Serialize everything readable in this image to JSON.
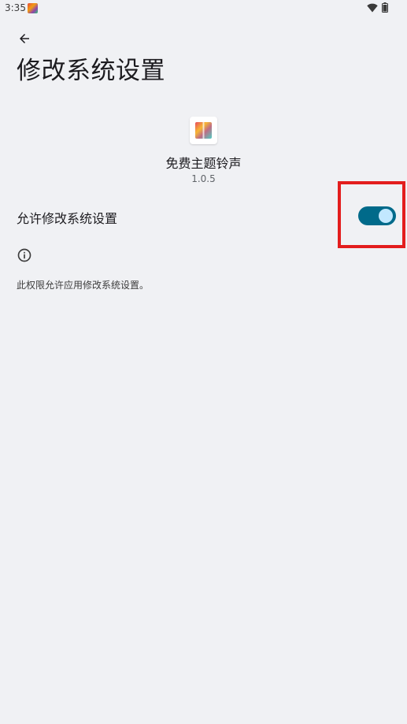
{
  "status_bar": {
    "time": "3:35",
    "notification_icon": "app-notification-icon",
    "wifi_icon": "wifi-icon",
    "battery_icon": "battery-icon"
  },
  "toolbar": {
    "back_icon": "arrow-back-icon",
    "title": "修改系统设置"
  },
  "app": {
    "icon": "app-icon",
    "name": "免费主题铃声",
    "version": "1.0.5"
  },
  "setting": {
    "label": "允许修改系统设置",
    "toggle_on": true,
    "toggle_track_color": "#006a8a",
    "toggle_thumb_color": "#c2e8ff"
  },
  "info": {
    "icon": "info-icon",
    "text": "此权限允许应用修改系统设置。"
  },
  "highlight": {
    "color": "#e31d1d"
  }
}
